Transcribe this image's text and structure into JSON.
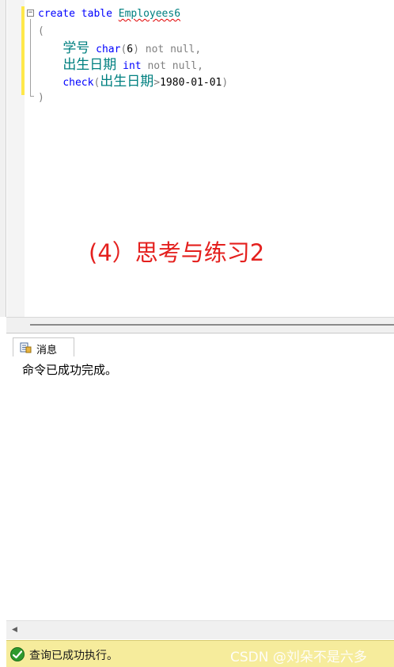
{
  "editor": {
    "fold_glyph": "−",
    "lines": {
      "l1": {
        "kw1": "create",
        "kw2": "table",
        "table_name": "Employees6"
      },
      "l2": {
        "paren": "("
      },
      "l3": {
        "col": "学号",
        "type": "char",
        "open": "(",
        "size": "6",
        "close": ")",
        "constraint": "not null,"
      },
      "l4": {
        "col": "出生日期",
        "type": "int",
        "constraint": "not null,"
      },
      "l5": {
        "kw": "check",
        "open": "(",
        "col": "出生日期",
        "op": ">",
        "value": "1980-01-01",
        "close": ")"
      },
      "l6": {
        "paren": ")"
      }
    }
  },
  "caption": "(4）思考与练习2",
  "results": {
    "tab_label": "消息",
    "message": "命令已成功完成。"
  },
  "statusbar": {
    "text": "查询已成功执行。",
    "watermark": "CSDN @刘朵不是六多"
  },
  "colors": {
    "keyword": "#0000ff",
    "identifier": "#008080",
    "caption": "#e4201e",
    "status_bg": "#f6ec9c"
  }
}
